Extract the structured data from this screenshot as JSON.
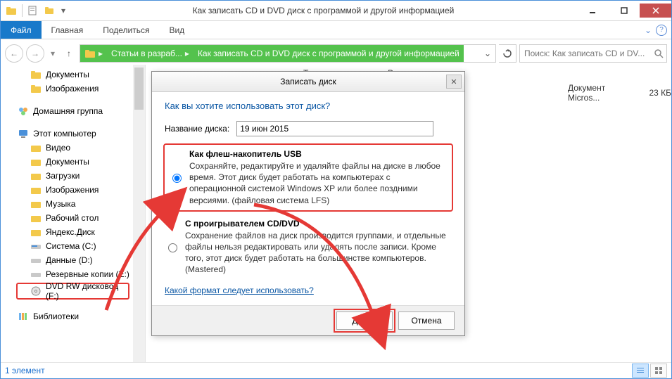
{
  "window": {
    "title": "Как записать CD и DVD диск с программой и другой информацией"
  },
  "ribbon": {
    "file": "Файл",
    "home": "Главная",
    "share": "Поделиться",
    "view": "Вид"
  },
  "breadcrumb": {
    "seg1": "Статьи в разраб...",
    "seg2": "Как записать CD и DVD диск с программой и другой информацией"
  },
  "search": {
    "placeholder": "Поиск: Как записать CD и DV..."
  },
  "sidebar": {
    "documents": "Документы",
    "pictures": "Изображения",
    "homegroup": "Домашняя группа",
    "thispc": "Этот компьютер",
    "videos": "Видео",
    "documents2": "Документы",
    "downloads": "Загрузки",
    "pictures2": "Изображения",
    "music": "Музыка",
    "desktop": "Рабочий стол",
    "yandexdisk": "Яндекс.Диск",
    "drive_c": "Система (C:)",
    "drive_d": "Данные (D:)",
    "drive_e": "Резервные копии (E:)",
    "dvd_f": "DVD RW дисковод (F:)",
    "libraries": "Библиотеки"
  },
  "columns": {
    "type": "Тип",
    "size": "Размер"
  },
  "row": {
    "type": "Документ Micros...",
    "size": "23 КБ"
  },
  "status": {
    "count": "1 элемент"
  },
  "dialog": {
    "title": "Записать диск",
    "question": "Как вы хотите использовать этот диск?",
    "disc_name_label": "Название диска:",
    "disc_name_value": "19 июн 2015",
    "opt1_title": "Как флеш-накопитель USB",
    "opt1_desc": "Сохраняйте, редактируйте и удаляйте файлы на диске в любое время. Этот диск будет работать на компьютерах с операционной системой Windows XP или более поздними версиями. (файловая система LFS)",
    "opt2_title": "С проигрывателем CD/DVD",
    "opt2_desc": "Сохранение файлов на диск производится группами, и отдельные файлы нельзя редактировать или удалять после записи. Кроме того, этот диск будет работать на большинстве компьютеров. (Mastered)",
    "link": "Какой формат следует использовать?",
    "next": "Далее",
    "cancel": "Отмена"
  }
}
